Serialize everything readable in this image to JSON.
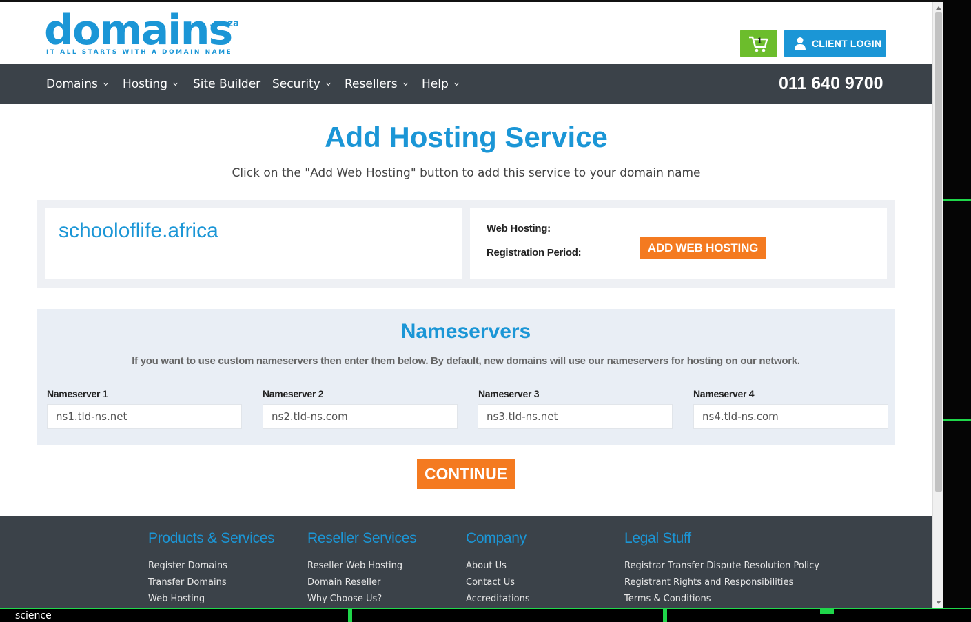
{
  "header": {
    "logo_text": "domains",
    "logo_tld": ".co.za",
    "logo_tagline": "IT ALL STARTS WITH A DOMAIN NAME",
    "cart_count": "1",
    "login_label": "CLIENT LOGIN"
  },
  "nav": {
    "items": [
      {
        "label": "Domains",
        "has_dropdown": true
      },
      {
        "label": "Hosting",
        "has_dropdown": true
      },
      {
        "label": "Site Builder",
        "has_dropdown": false
      },
      {
        "label": "Security",
        "has_dropdown": true
      },
      {
        "label": "Resellers",
        "has_dropdown": true
      },
      {
        "label": "Help",
        "has_dropdown": true
      }
    ],
    "phone": "011 640 9700"
  },
  "main": {
    "title": "Add Hosting Service",
    "subtitle": "Click on the \"Add Web Hosting\" button to add this service to your domain name",
    "domain": "schooloflife.africa",
    "web_hosting_label": "Web Hosting:",
    "registration_period_label": "Registration Period:",
    "add_hosting_button": "ADD WEB HOSTING"
  },
  "nameservers": {
    "title": "Nameservers",
    "description": "If you want to use custom nameservers then enter them below. By default, new domains will use our nameservers for hosting on our network.",
    "fields": [
      {
        "label": "Nameserver 1",
        "placeholder": "ns1.tld-ns.net"
      },
      {
        "label": "Nameserver 2",
        "placeholder": "ns2.tld-ns.com"
      },
      {
        "label": "Nameserver 3",
        "placeholder": "ns3.tld-ns.net"
      },
      {
        "label": "Nameserver 4",
        "placeholder": "ns4.tld-ns.com"
      }
    ],
    "continue_button": "CONTINUE"
  },
  "footer": {
    "columns": [
      {
        "heading": "Products & Services",
        "links": [
          "Register Domains",
          "Transfer Domains",
          "Web Hosting"
        ]
      },
      {
        "heading": "Reseller Services",
        "links": [
          "Reseller Web Hosting",
          "Domain Reseller",
          "Why Choose Us?"
        ]
      },
      {
        "heading": "Company",
        "links": [
          "About Us",
          "Contact Us",
          "Accreditations"
        ]
      },
      {
        "heading": "Legal Stuff",
        "links": [
          "Registrar Transfer Dispute Resolution Policy",
          "Registrant Rights and Responsibilities",
          "Terms & Conditions"
        ]
      }
    ]
  },
  "taskbar": {
    "label": "science"
  },
  "colors": {
    "brand_blue": "#1b96d6",
    "accent_orange": "#f47a20",
    "cart_green": "#6cbd2c",
    "nav_dark": "#3b4249"
  }
}
